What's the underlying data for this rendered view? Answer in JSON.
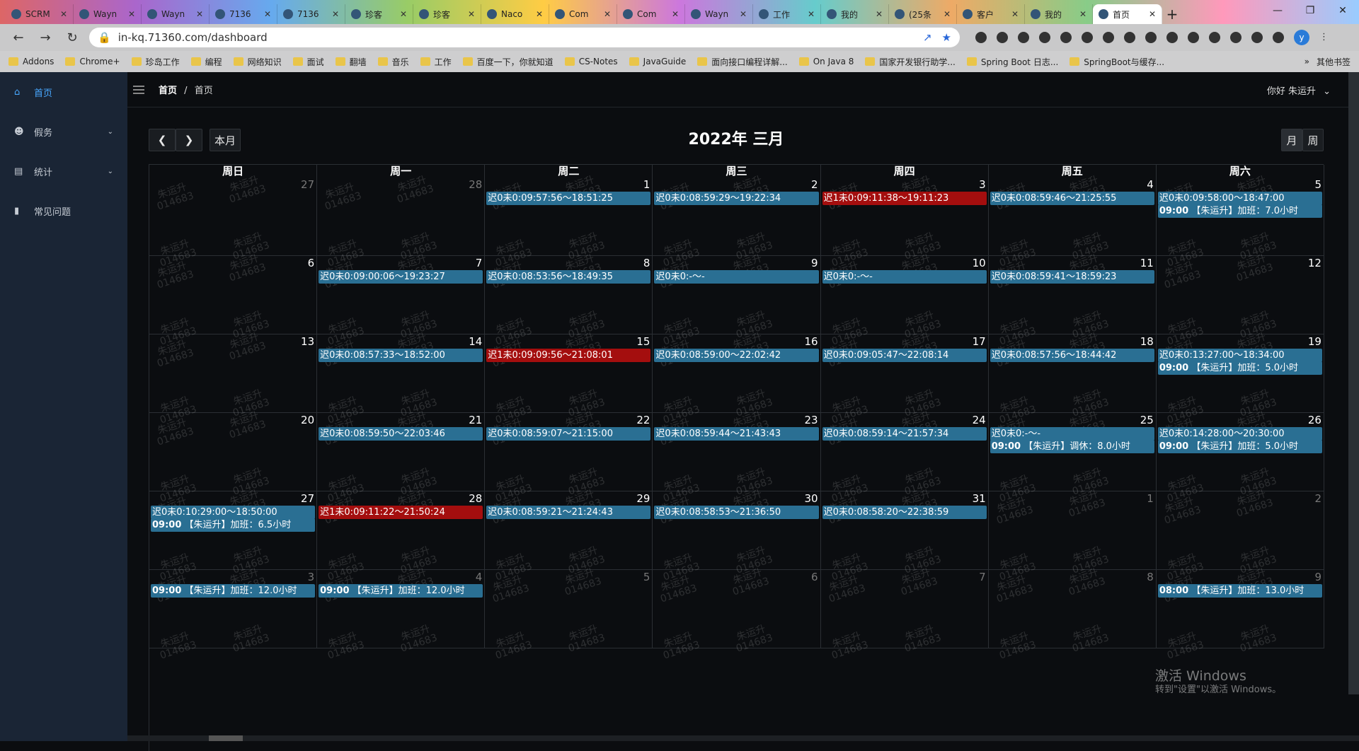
{
  "browser": {
    "tabs": [
      {
        "label": "SCRM"
      },
      {
        "label": "Wayn"
      },
      {
        "label": "Wayn"
      },
      {
        "label": "7136"
      },
      {
        "label": "7136"
      },
      {
        "label": "珍客"
      },
      {
        "label": "珍客"
      },
      {
        "label": "Naco"
      },
      {
        "label": "Com"
      },
      {
        "label": "Com"
      },
      {
        "label": "Wayn"
      },
      {
        "label": "工作"
      },
      {
        "label": "我的"
      },
      {
        "label": "(25条"
      },
      {
        "label": "客户"
      },
      {
        "label": "我的"
      },
      {
        "label": "首页",
        "active": true
      }
    ],
    "url": "in-kq.71360.com/dashboard",
    "bookmarks": [
      "Addons",
      "Chrome+",
      "珍岛工作",
      "编程",
      "网络知识",
      "面试",
      "翻墙",
      "音乐",
      "工作",
      "百度一下，你就知道",
      "CS-Notes",
      "JavaGuide",
      "面向接口编程详解...",
      "On Java 8",
      "国家开发银行助学...",
      "Spring Boot 日志...",
      "SpringBoot与缓存..."
    ],
    "other_bookmarks": "其他书签",
    "profile_initial": "y"
  },
  "sidebar": {
    "items": [
      {
        "label": "首页",
        "icon": "home-icon",
        "active": true
      },
      {
        "label": "假务",
        "icon": "user-icon",
        "expandable": true
      },
      {
        "label": "统计",
        "icon": "chart-icon",
        "expandable": true
      },
      {
        "label": "常见问题",
        "icon": "doc-icon"
      }
    ]
  },
  "topbar": {
    "breadcrumb_root": "首页",
    "breadcrumb_sep": "/",
    "breadcrumb_current": "首页",
    "greeting": "你好  朱运升"
  },
  "calendar": {
    "title": "2022年 三月",
    "prev_icon": "chevron-left-icon",
    "next_icon": "chevron-right-icon",
    "today_label": "本月",
    "view_month": "月",
    "view_week": "周",
    "weekdays": [
      "周日",
      "周一",
      "周二",
      "周三",
      "周四",
      "周五",
      "周六"
    ],
    "watermark_name": "朱运升",
    "watermark_id": "014683",
    "weeks": [
      [
        {
          "day": "27",
          "other": true,
          "events": []
        },
        {
          "day": "28",
          "other": true,
          "events": []
        },
        {
          "day": "1",
          "events": [
            {
              "text": "迟0未0:09:57:56～18:51:25"
            }
          ]
        },
        {
          "day": "2",
          "events": [
            {
              "text": "迟0未0:08:59:29～19:22:34"
            }
          ]
        },
        {
          "day": "3",
          "events": [
            {
              "text": "迟1未0:09:11:38～19:11:23",
              "red": true
            }
          ]
        },
        {
          "day": "4",
          "events": [
            {
              "text": "迟0未0:08:59:46～21:25:55"
            }
          ]
        },
        {
          "day": "5",
          "events": [
            {
              "text": "迟0未0:09:58:00～18:47:00"
            },
            {
              "time": "09:00",
              "text": " 【朱运升】加班：7.0小时"
            }
          ]
        }
      ],
      [
        {
          "day": "6",
          "events": []
        },
        {
          "day": "7",
          "events": [
            {
              "text": "迟0未0:09:00:06～19:23:27"
            }
          ]
        },
        {
          "day": "8",
          "events": [
            {
              "text": "迟0未0:08:53:56～18:49:35"
            }
          ]
        },
        {
          "day": "9",
          "events": [
            {
              "text": "迟0未0:-～-"
            }
          ]
        },
        {
          "day": "10",
          "events": [
            {
              "text": "迟0未0:-～-"
            }
          ]
        },
        {
          "day": "11",
          "events": [
            {
              "text": "迟0未0:08:59:41～18:59:23"
            }
          ]
        },
        {
          "day": "12",
          "events": []
        }
      ],
      [
        {
          "day": "13",
          "events": []
        },
        {
          "day": "14",
          "events": [
            {
              "text": "迟0未0:08:57:33～18:52:00"
            }
          ]
        },
        {
          "day": "15",
          "events": [
            {
              "text": "迟1未0:09:09:56～21:08:01",
              "red": true
            }
          ]
        },
        {
          "day": "16",
          "events": [
            {
              "text": "迟0未0:08:59:00～22:02:42"
            }
          ]
        },
        {
          "day": "17",
          "events": [
            {
              "text": "迟0未0:09:05:47～22:08:14"
            }
          ]
        },
        {
          "day": "18",
          "events": [
            {
              "text": "迟0未0:08:57:56～18:44:42"
            }
          ]
        },
        {
          "day": "19",
          "events": [
            {
              "text": "迟0未0:13:27:00～18:34:00"
            },
            {
              "time": "09:00",
              "text": " 【朱运升】加班：5.0小时"
            }
          ]
        }
      ],
      [
        {
          "day": "20",
          "events": []
        },
        {
          "day": "21",
          "events": [
            {
              "text": "迟0未0:08:59:50～22:03:46"
            }
          ]
        },
        {
          "day": "22",
          "events": [
            {
              "text": "迟0未0:08:59:07～21:15:00"
            }
          ]
        },
        {
          "day": "23",
          "events": [
            {
              "text": "迟0未0:08:59:44～21:43:43"
            }
          ]
        },
        {
          "day": "24",
          "events": [
            {
              "text": "迟0未0:08:59:14～21:57:34"
            }
          ]
        },
        {
          "day": "25",
          "events": [
            {
              "text": "迟0未0:-～-"
            },
            {
              "time": "09:00",
              "text": " 【朱运升】调休：8.0小时"
            }
          ]
        },
        {
          "day": "26",
          "events": [
            {
              "text": "迟0未0:14:28:00～20:30:00"
            },
            {
              "time": "09:00",
              "text": " 【朱运升】加班：5.0小时"
            }
          ]
        }
      ],
      [
        {
          "day": "27",
          "events": [
            {
              "text": "迟0未0:10:29:00～18:50:00"
            },
            {
              "time": "09:00",
              "text": " 【朱运升】加班：6.5小时"
            }
          ]
        },
        {
          "day": "28",
          "events": [
            {
              "text": "迟1未0:09:11:22～21:50:24",
              "red": true
            }
          ]
        },
        {
          "day": "29",
          "events": [
            {
              "text": "迟0未0:08:59:21～21:24:43"
            }
          ]
        },
        {
          "day": "30",
          "events": [
            {
              "text": "迟0未0:08:58:53～21:36:50"
            }
          ]
        },
        {
          "day": "31",
          "events": [
            {
              "text": "迟0未0:08:58:20～22:38:59"
            }
          ]
        },
        {
          "day": "1",
          "other": true,
          "events": []
        },
        {
          "day": "2",
          "other": true,
          "events": []
        }
      ],
      [
        {
          "day": "3",
          "other": true,
          "events": [
            {
              "time": "09:00",
              "text": " 【朱运升】加班：12.0小时"
            }
          ]
        },
        {
          "day": "4",
          "other": true,
          "events": [
            {
              "time": "09:00",
              "text": " 【朱运升】加班：12.0小时"
            }
          ]
        },
        {
          "day": "5",
          "other": true,
          "events": []
        },
        {
          "day": "6",
          "other": true,
          "events": []
        },
        {
          "day": "7",
          "other": true,
          "events": []
        },
        {
          "day": "8",
          "other": true,
          "events": []
        },
        {
          "day": "9",
          "other": true,
          "events": [
            {
              "time": "08:00",
              "text": " 【朱运升】加班：13.0小时"
            }
          ]
        }
      ]
    ]
  },
  "windows_activation": {
    "line1": "激活 Windows",
    "line2": "转到\"设置\"以激活 Windows。"
  },
  "colors": {
    "event_blue": "#2a6f93",
    "event_red": "#a40e0e",
    "sidebar_bg": "#1a2535",
    "accent": "#48a8ff"
  }
}
